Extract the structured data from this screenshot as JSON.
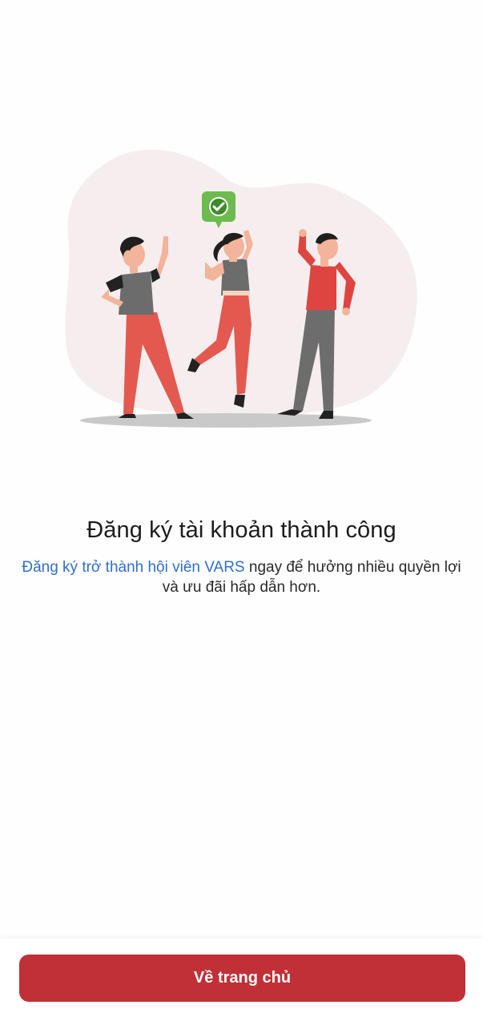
{
  "success": {
    "title": "Đăng ký tài khoản thành công",
    "description_link": "Đăng ký trở thành hội viên VARS",
    "description_text": " ngay để hưởng nhiều quyền lợi và ưu đãi hấp dẫn hơn."
  },
  "actions": {
    "home_button": "Về trang chủ"
  },
  "colors": {
    "primary": "#c03036",
    "link": "#2f6fd1",
    "check_badge": "#6dbb4f"
  },
  "illustration": {
    "icon": "celebrating-people-illustration",
    "badge_icon": "check-icon"
  }
}
